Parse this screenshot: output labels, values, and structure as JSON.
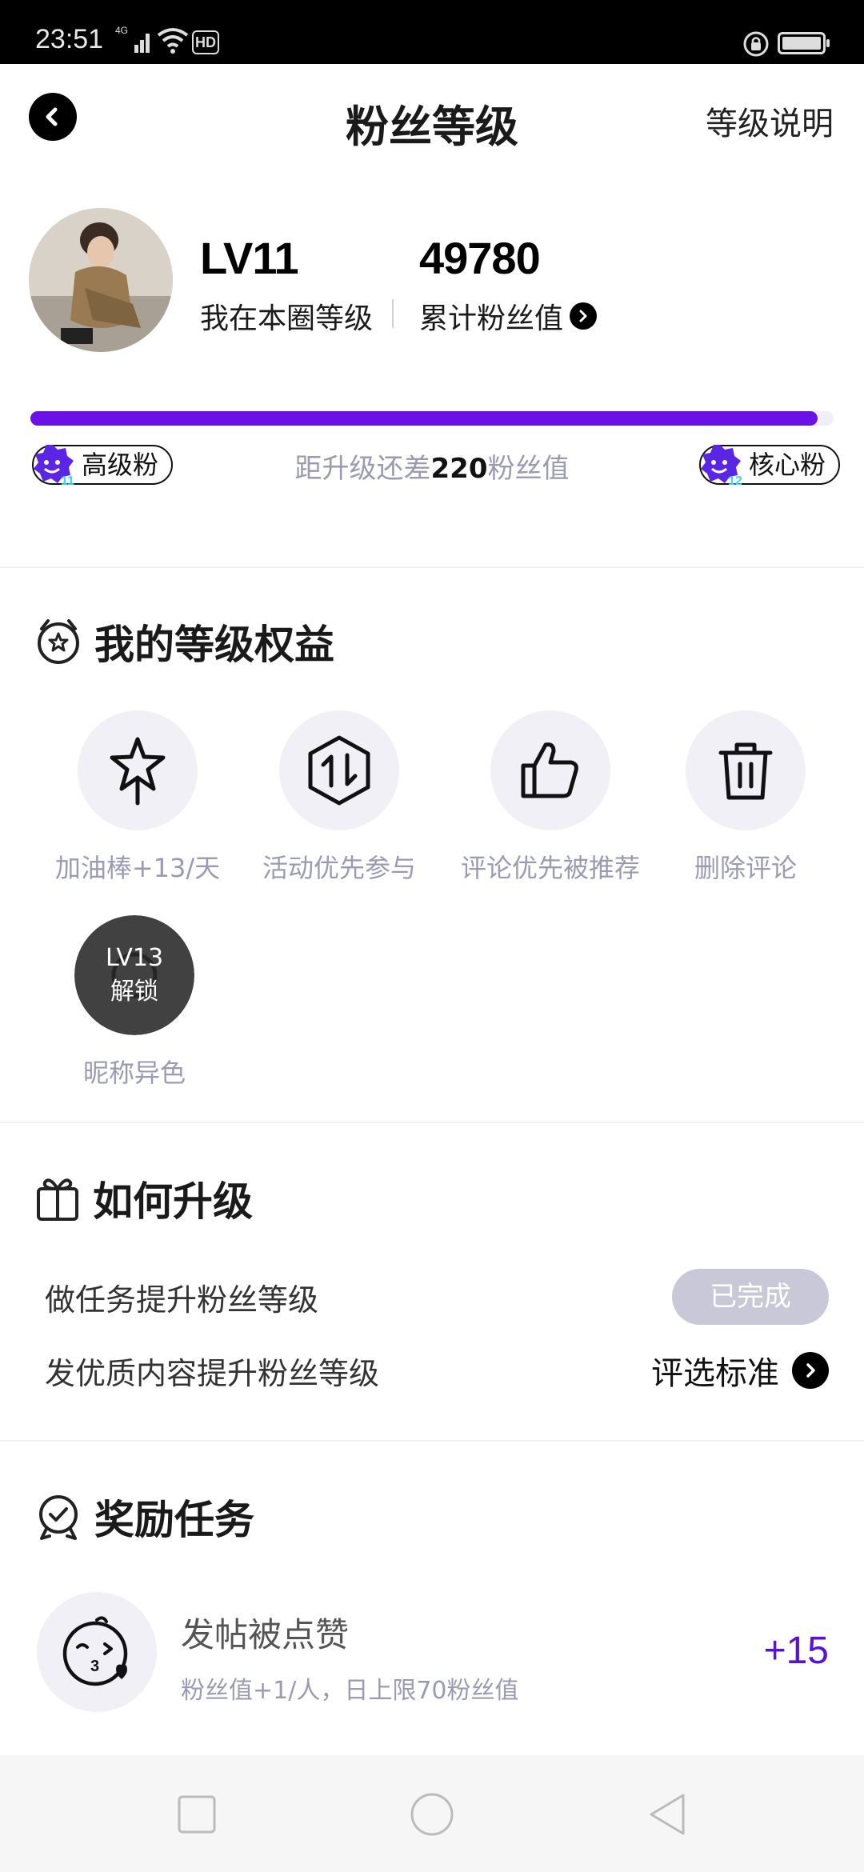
{
  "status_bar": {
    "time": "23:51",
    "network": "4G",
    "hd": "HD"
  },
  "header": {
    "title": "粉丝等级",
    "help_link": "等级说明"
  },
  "profile": {
    "level_value": "LV11",
    "level_label": "我在本圈等级",
    "fan_value": "49780",
    "fan_label": "累计粉丝值"
  },
  "progress": {
    "fraction": 0.98,
    "current_tier": "高级粉",
    "current_tier_num": "11",
    "next_tier": "核心粉",
    "next_tier_num": "12",
    "text_before": "距升级还差",
    "remaining": "220",
    "text_after": "粉丝值",
    "accent_color": "#6a11e8"
  },
  "benefits": {
    "title": "我的等级权益",
    "items": [
      {
        "label": "加油棒+13/天",
        "icon": "star-wand-icon"
      },
      {
        "label": "活动优先参与",
        "icon": "exchange-icon"
      },
      {
        "label": "评论优先被推荐",
        "icon": "thumbs-up-icon"
      },
      {
        "label": "删除评论",
        "icon": "trash-icon"
      },
      {
        "label": "昵称异色",
        "icon": "palette-icon",
        "lock_level": "LV13",
        "lock_text": "解锁"
      }
    ]
  },
  "upgrade": {
    "title": "如何升级",
    "task_row": {
      "text": "做任务提升粉丝等级",
      "button": "已完成"
    },
    "content_row": {
      "text": "发优质内容提升粉丝等级",
      "link": "评选标准"
    }
  },
  "rewards": {
    "title": "奖励任务",
    "task": {
      "title": "发帖被点赞",
      "desc": "粉丝值+1/人，日上限70粉丝值",
      "points": "+15",
      "icon": "kiss-face-icon"
    }
  }
}
